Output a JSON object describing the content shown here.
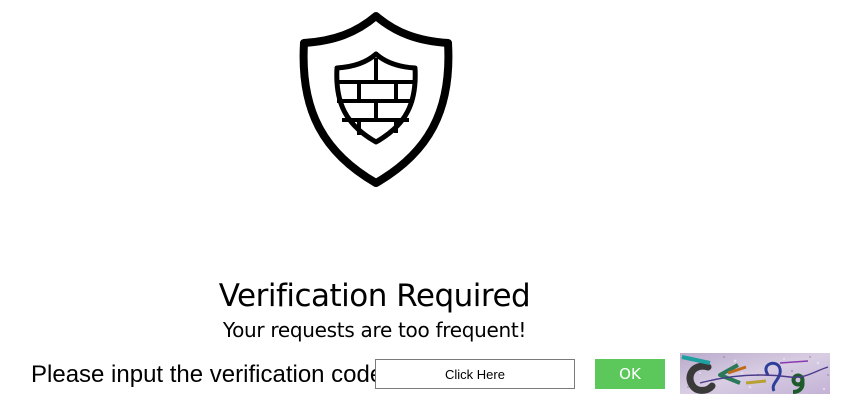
{
  "page": {
    "title": "Verification Required",
    "subtitle": "Your requests are too frequent!"
  },
  "form": {
    "prompt_label": "Please input the verification code:",
    "code_input": {
      "value": "",
      "placeholder": "Click Here"
    },
    "ok_label": "OK"
  },
  "icons": {
    "logo": "shield-brick-wall-icon",
    "captcha": "captcha-image"
  },
  "colors": {
    "ok_button": "#5cc85c",
    "ok_text": "#ffffff",
    "captcha_background": "#c9b8d8"
  }
}
